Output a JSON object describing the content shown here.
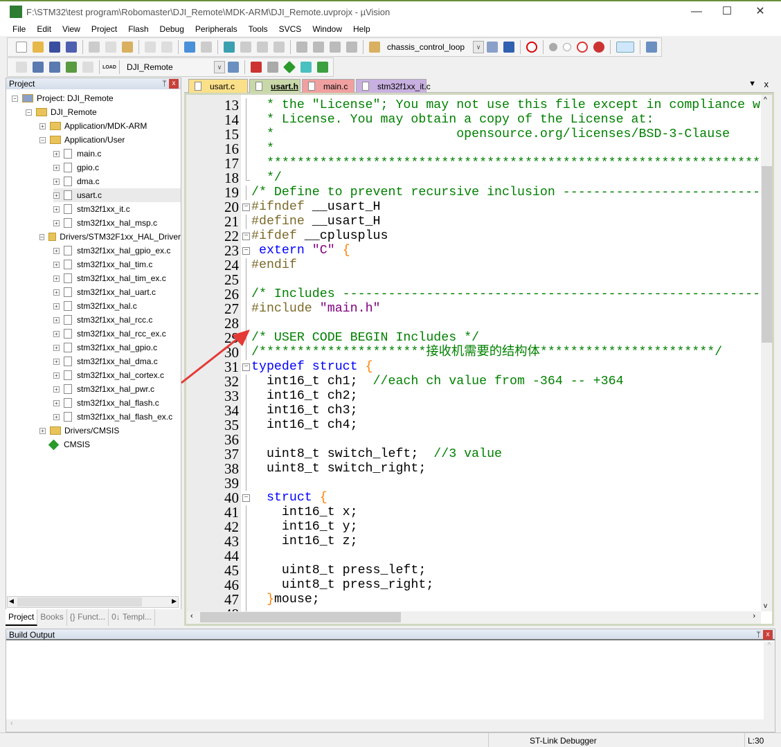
{
  "window": {
    "title": "F:\\STM32\\test program\\Robomaster\\DJI_Remote\\MDK-ARM\\DJI_Remote.uvprojx - µVision",
    "logo": "µV"
  },
  "menu": [
    "File",
    "Edit",
    "View",
    "Project",
    "Flash",
    "Debug",
    "Peripherals",
    "Tools",
    "SVCS",
    "Window",
    "Help"
  ],
  "toolbar": {
    "find_value": "chassis_control_loop",
    "target_value": "DJI_Remote",
    "load_label": "LOAD"
  },
  "project": {
    "title": "Project",
    "pin": "ᛘ",
    "close": "x",
    "tree": [
      {
        "label": "Project: DJI_Remote",
        "level": 0,
        "kind": "root",
        "exp": "−"
      },
      {
        "label": "DJI_Remote",
        "level": 1,
        "kind": "folder",
        "exp": "−"
      },
      {
        "label": "Application/MDK-ARM",
        "level": 2,
        "kind": "folder",
        "exp": "+"
      },
      {
        "label": "Application/User",
        "level": 2,
        "kind": "folder",
        "exp": "−"
      },
      {
        "label": "main.c",
        "level": 3,
        "kind": "file",
        "exp": "+"
      },
      {
        "label": "gpio.c",
        "level": 3,
        "kind": "file",
        "exp": "+"
      },
      {
        "label": "dma.c",
        "level": 3,
        "kind": "file",
        "exp": "+"
      },
      {
        "label": "usart.c",
        "level": 3,
        "kind": "file",
        "exp": "+",
        "selected": true
      },
      {
        "label": "stm32f1xx_it.c",
        "level": 3,
        "kind": "file",
        "exp": "+"
      },
      {
        "label": "stm32f1xx_hal_msp.c",
        "level": 3,
        "kind": "file",
        "exp": "+"
      },
      {
        "label": "Drivers/STM32F1xx_HAL_Driver",
        "level": 2,
        "kind": "folder",
        "exp": "−"
      },
      {
        "label": "stm32f1xx_hal_gpio_ex.c",
        "level": 3,
        "kind": "file",
        "exp": "+"
      },
      {
        "label": "stm32f1xx_hal_tim.c",
        "level": 3,
        "kind": "file",
        "exp": "+"
      },
      {
        "label": "stm32f1xx_hal_tim_ex.c",
        "level": 3,
        "kind": "file",
        "exp": "+"
      },
      {
        "label": "stm32f1xx_hal_uart.c",
        "level": 3,
        "kind": "file",
        "exp": "+"
      },
      {
        "label": "stm32f1xx_hal.c",
        "level": 3,
        "kind": "file",
        "exp": "+"
      },
      {
        "label": "stm32f1xx_hal_rcc.c",
        "level": 3,
        "kind": "file",
        "exp": "+"
      },
      {
        "label": "stm32f1xx_hal_rcc_ex.c",
        "level": 3,
        "kind": "file",
        "exp": "+"
      },
      {
        "label": "stm32f1xx_hal_gpio.c",
        "level": 3,
        "kind": "file",
        "exp": "+"
      },
      {
        "label": "stm32f1xx_hal_dma.c",
        "level": 3,
        "kind": "file",
        "exp": "+"
      },
      {
        "label": "stm32f1xx_hal_cortex.c",
        "level": 3,
        "kind": "file",
        "exp": "+"
      },
      {
        "label": "stm32f1xx_hal_pwr.c",
        "level": 3,
        "kind": "file",
        "exp": "+"
      },
      {
        "label": "stm32f1xx_hal_flash.c",
        "level": 3,
        "kind": "file",
        "exp": "+"
      },
      {
        "label": "stm32f1xx_hal_flash_ex.c",
        "level": 3,
        "kind": "file",
        "exp": "+"
      },
      {
        "label": "Drivers/CMSIS",
        "level": 2,
        "kind": "folder",
        "exp": "+"
      },
      {
        "label": "CMSIS",
        "level": 2,
        "kind": "cmsis",
        "exp": ""
      }
    ],
    "tabs": [
      {
        "label": "Project",
        "active": true
      },
      {
        "label": "Books"
      },
      {
        "label": "{} Funct..."
      },
      {
        "label": "0↓ Templ..."
      }
    ]
  },
  "editor": {
    "tabs": [
      {
        "label": "usart.c",
        "color": "#fbe08a"
      },
      {
        "label": "usart.h",
        "color": "#c8d8a8",
        "active": true
      },
      {
        "label": "main.c",
        "color": "#f0a0a0"
      },
      {
        "label": "stm32f1xx_it.c",
        "color": "#c8b0e0"
      }
    ],
    "tab_menu": "▼",
    "tab_close": "x",
    "lines": [
      {
        "n": "13",
        "t": [
          [
            "c",
            "  * the \"License\"; You may not use this file except in compliance w"
          ]
        ]
      },
      {
        "n": "14",
        "t": [
          [
            "c",
            "  * License. You may obtain a copy of the License at:"
          ]
        ]
      },
      {
        "n": "15",
        "t": [
          [
            "c",
            "  *                        opensource.org/licenses/BSD-3-Clause"
          ]
        ]
      },
      {
        "n": "16",
        "t": [
          [
            "c",
            "  *"
          ]
        ]
      },
      {
        "n": "17",
        "t": [
          [
            "c",
            "  *****************************************************************************"
          ]
        ]
      },
      {
        "n": "18",
        "end": true,
        "t": [
          [
            "c",
            "  */"
          ]
        ]
      },
      {
        "n": "19",
        "t": [
          [
            "c",
            "/* Define to prevent recursive inclusion -------------------------------------"
          ]
        ]
      },
      {
        "n": "20",
        "fold": true,
        "t": [
          [
            "p",
            "#ifndef"
          ],
          [
            "t",
            " __usart_H"
          ]
        ]
      },
      {
        "n": "21",
        "t": [
          [
            "p",
            "#define"
          ],
          [
            "t",
            " __usart_H"
          ]
        ]
      },
      {
        "n": "22",
        "fold": true,
        "t": [
          [
            "p",
            "#ifdef"
          ],
          [
            "t",
            " __cplusplus"
          ]
        ]
      },
      {
        "n": "23",
        "fold": true,
        "t": [
          [
            "k",
            " extern"
          ],
          [
            "t",
            " "
          ],
          [
            "s",
            "\"C\""
          ],
          [
            "t",
            " "
          ],
          [
            "b",
            "{"
          ]
        ]
      },
      {
        "n": "24",
        "t": [
          [
            "p",
            "#endif"
          ]
        ]
      },
      {
        "n": "25",
        "t": []
      },
      {
        "n": "26",
        "t": [
          [
            "c",
            "/* Includes ------------------------------------------------------------------"
          ]
        ]
      },
      {
        "n": "27",
        "t": [
          [
            "p",
            "#include"
          ],
          [
            "t",
            " "
          ],
          [
            "s",
            "\"main.h\""
          ]
        ]
      },
      {
        "n": "28",
        "t": []
      },
      {
        "n": "29",
        "t": [
          [
            "c",
            "/* USER CODE BEGIN Includes */"
          ]
        ]
      },
      {
        "n": "30",
        "t": [
          [
            "c",
            "/**********************接收机需要的结构体***********************/"
          ]
        ]
      },
      {
        "n": "31",
        "fold": true,
        "t": [
          [
            "k",
            "typedef"
          ],
          [
            "t",
            " "
          ],
          [
            "k",
            "struct"
          ],
          [
            "t",
            " "
          ],
          [
            "b",
            "{"
          ]
        ]
      },
      {
        "n": "32",
        "t": [
          [
            "t",
            "  int16_t ch1;  "
          ],
          [
            "c",
            "//each ch value from -364 -- +364"
          ]
        ]
      },
      {
        "n": "33",
        "t": [
          [
            "t",
            "  int16_t ch2;"
          ]
        ]
      },
      {
        "n": "34",
        "t": [
          [
            "t",
            "  int16_t ch3;"
          ]
        ]
      },
      {
        "n": "35",
        "t": [
          [
            "t",
            "  int16_t ch4;"
          ]
        ]
      },
      {
        "n": "36",
        "t": []
      },
      {
        "n": "37",
        "t": [
          [
            "t",
            "  uint8_t switch_left;  "
          ],
          [
            "c",
            "//3 value"
          ]
        ]
      },
      {
        "n": "38",
        "t": [
          [
            "t",
            "  uint8_t switch_right;"
          ]
        ]
      },
      {
        "n": "39",
        "t": []
      },
      {
        "n": "40",
        "fold": true,
        "t": [
          [
            "t",
            "  "
          ],
          [
            "k",
            "struct"
          ],
          [
            "t",
            " "
          ],
          [
            "b",
            "{"
          ]
        ]
      },
      {
        "n": "41",
        "t": [
          [
            "t",
            "    int16_t x;"
          ]
        ]
      },
      {
        "n": "42",
        "t": [
          [
            "t",
            "    int16_t y;"
          ]
        ]
      },
      {
        "n": "43",
        "t": [
          [
            "t",
            "    int16_t z;"
          ]
        ]
      },
      {
        "n": "44",
        "t": []
      },
      {
        "n": "45",
        "t": [
          [
            "t",
            "    uint8_t press_left;"
          ]
        ]
      },
      {
        "n": "46",
        "t": [
          [
            "t",
            "    uint8_t press_right;"
          ]
        ]
      },
      {
        "n": "47",
        "t": [
          [
            "t",
            "  "
          ],
          [
            "b",
            "}"
          ],
          [
            "t",
            "mouse;"
          ]
        ]
      },
      {
        "n": "48",
        "t": []
      }
    ]
  },
  "build": {
    "title": "Build Output",
    "pin": "ᛘ",
    "close": "x"
  },
  "status": {
    "debugger": "ST-Link Debugger",
    "position": "L:30"
  },
  "colors": {
    "comment": "#008000",
    "keyword": "#0000ff",
    "string": "#800080",
    "preprocessor": "#7b6a2a",
    "annotation_arrow": "#e53935"
  }
}
